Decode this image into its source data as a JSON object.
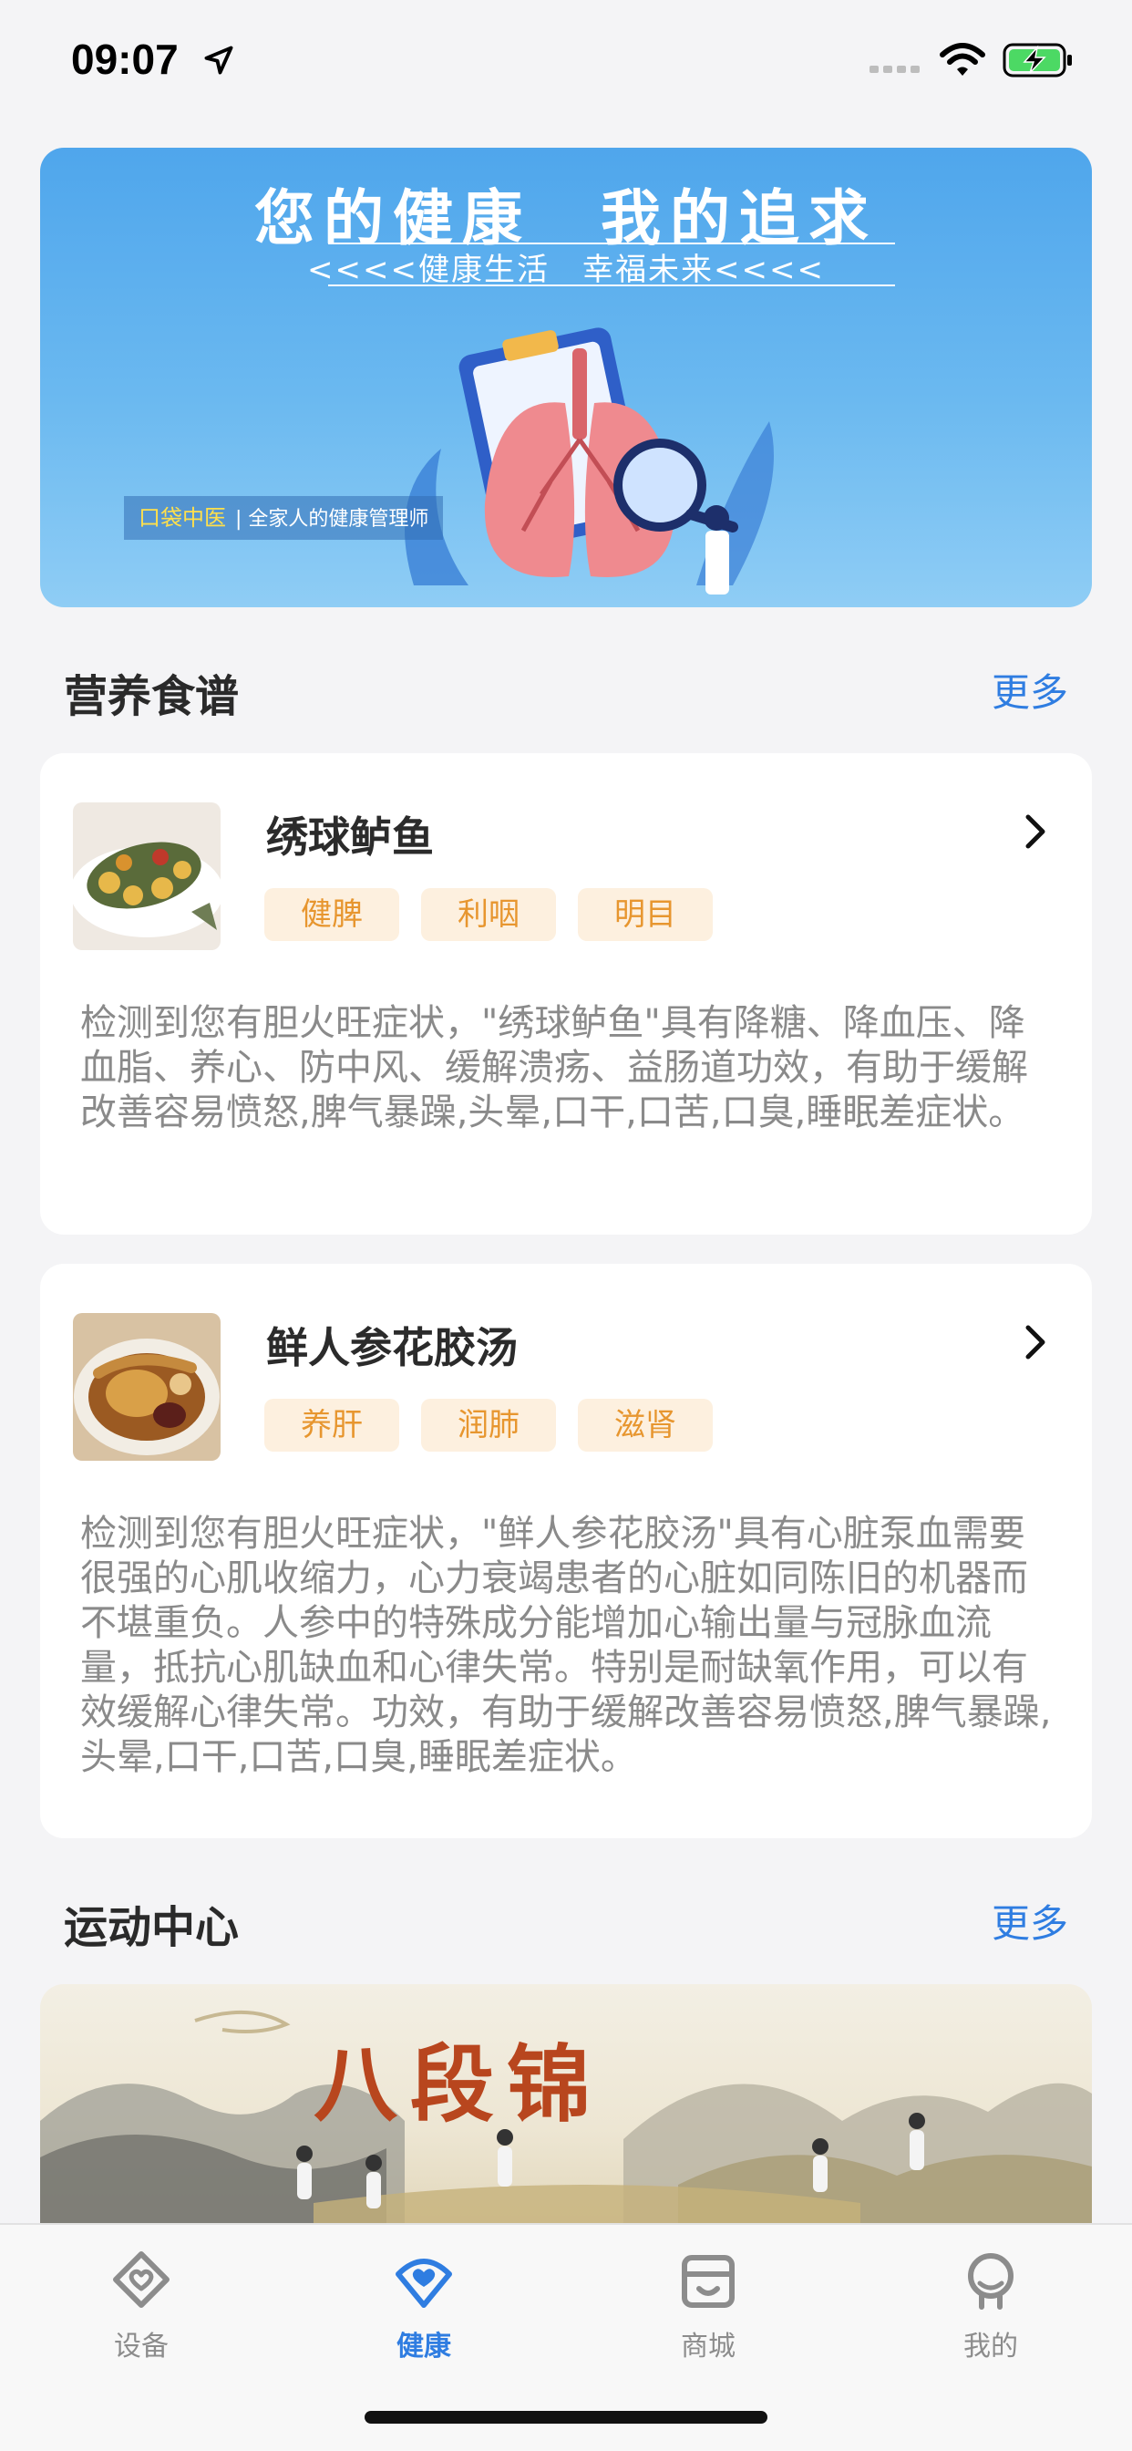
{
  "status_bar": {
    "time": "09:07"
  },
  "banner": {
    "title": "您的健康　我的追求",
    "subtitle": "<<<<健康生活　幸福未来<<<<",
    "brand": "口袋中医",
    "tagline": "| 全家人的健康管理师"
  },
  "nutrition": {
    "title": "营养食谱",
    "more": "更多",
    "recipes": [
      {
        "name": "绣球鲈鱼",
        "tags": [
          "健脾",
          "利咽",
          "明目"
        ],
        "description": "检测到您有胆火旺症状，\"绣球鲈鱼\"具有降糖、降血压、降血脂、养心、防中风、缓解溃疡、益肠道功效，有助于缓解改善容易愤怒,脾气暴躁,头晕,口干,口苦,口臭,睡眠差症状。"
      },
      {
        "name": "鲜人参花胶汤",
        "tags": [
          "养肝",
          "润肺",
          "滋肾"
        ],
        "description": "检测到您有胆火旺症状，\"鲜人参花胶汤\"具有心脏泵血需要很强的心肌收缩力，心力衰竭患者的心脏如同陈旧的机器而不堪重负。人参中的特殊成分能增加心输出量与冠脉血流量，抵抗心肌缺血和心律失常。特别是耐缺氧作用，可以有效缓解心律失常。功效，有助于缓解改善容易愤怒,脾气暴躁,头晕,口干,口苦,口臭,睡眠差症状。"
      }
    ]
  },
  "exercise": {
    "title": "运动中心",
    "more": "更多",
    "banner_title": "八段锦"
  },
  "tab_bar": {
    "items": [
      {
        "label": "设备",
        "icon": "device-icon"
      },
      {
        "label": "健康",
        "icon": "health-icon",
        "active": true
      },
      {
        "label": "商城",
        "icon": "shop-icon"
      },
      {
        "label": "我的",
        "icon": "profile-icon"
      }
    ]
  },
  "colors": {
    "accent": "#2f7de1",
    "tag_bg": "#fdf0df",
    "tag_text": "#e7962f",
    "background": "#f4f4f6"
  }
}
